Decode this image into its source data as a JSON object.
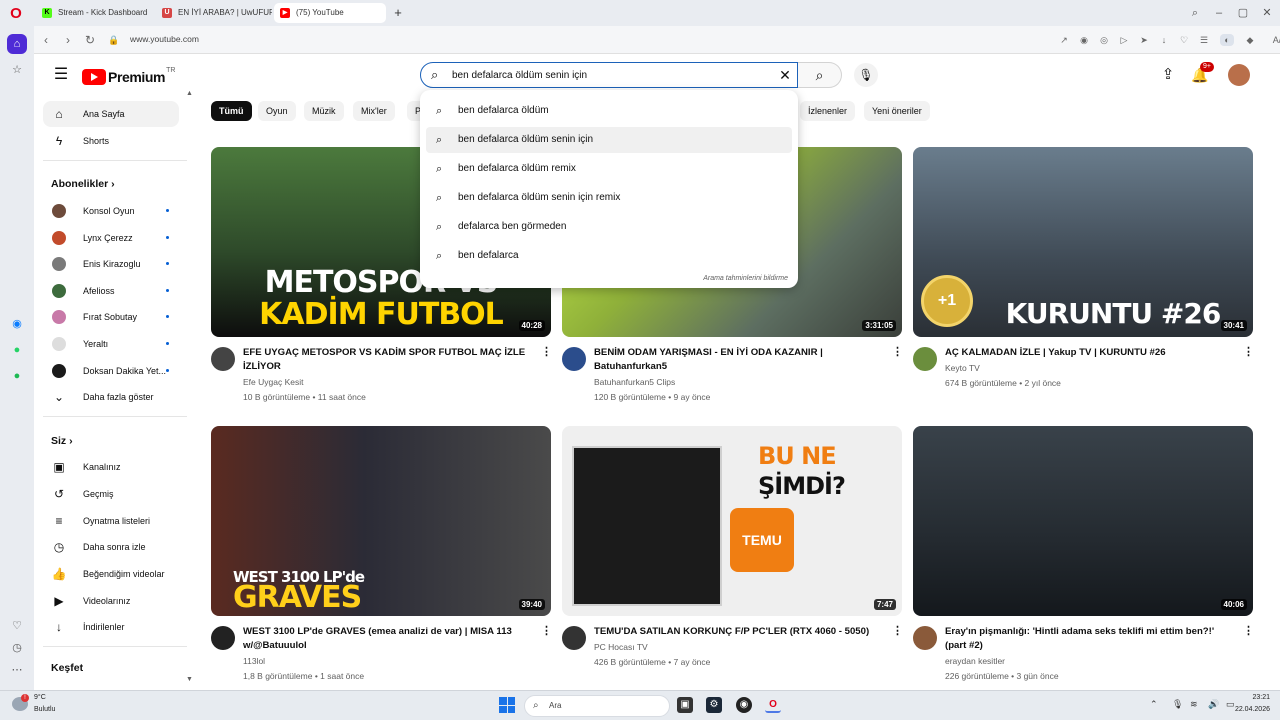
{
  "browser": {
    "tabs": [
      {
        "label": "Stream - Kick Dashboard",
        "fav": "K",
        "fav_color": "#53fc18"
      },
      {
        "label": "EN İYİ ARABA? | UwUFUFU",
        "fav": "U",
        "fav_color": "#d64545"
      },
      {
        "label": "(75) YouTube",
        "fav": "▶",
        "fav_color": "#ff0000"
      }
    ],
    "url": "www.youtube.com"
  },
  "youtube": {
    "logo_text": "Premium",
    "logo_region": "TR",
    "search_query": "ben defalarca öldüm senin için",
    "notif_count": "9+",
    "suggestions": [
      {
        "prefix": "ben defalarca ",
        "bold": "öldüm"
      },
      {
        "prefix": "ben defalarca ",
        "bold": "öldüm senin için"
      },
      {
        "prefix": "ben defalarca ",
        "bold": "öldüm remix"
      },
      {
        "prefix": "ben defalarca ",
        "bold": "öldüm senin için remix"
      },
      {
        "prefix": "defalarca ben ",
        "bold": "görmeden"
      },
      {
        "prefix": "ben defalarca",
        "bold": ""
      }
    ],
    "suggest_footer": "Arama tahminlerini bildirme",
    "nav": {
      "home": "Ana Sayfa",
      "shorts": "Shorts",
      "subs_heading": "Abonelikler",
      "subscriptions": [
        {
          "name": "Konsol Oyun",
          "color": "#6d4b3b"
        },
        {
          "name": "Lynx Çerezz",
          "color": "#c24b2b"
        },
        {
          "name": "Enis Kirazoglu",
          "color": "#7a7a7a"
        },
        {
          "name": "Afelioss",
          "color": "#3d6b3d"
        },
        {
          "name": "Fırat Sobutay",
          "color": "#c879a8"
        },
        {
          "name": "Yeraltı",
          "color": "#dddddd"
        },
        {
          "name": "Doksan Dakika Yet...",
          "color": "#1a1a1a"
        }
      ],
      "show_more": "Daha fazla göster",
      "you_heading": "Siz",
      "you_items": [
        {
          "label": "Kanalınız",
          "icon": "👤"
        },
        {
          "label": "Geçmiş",
          "icon": "↺"
        },
        {
          "label": "Oynatma listeleri",
          "icon": "≡"
        },
        {
          "label": "Daha sonra izle",
          "icon": "◷"
        },
        {
          "label": "Beğendiğim videolar",
          "icon": "👍"
        },
        {
          "label": "Videolarınız",
          "icon": "▶"
        },
        {
          "label": "İndirilenler",
          "icon": "↓"
        }
      ],
      "explore_heading": "Keşfet"
    },
    "chips": [
      "Tümü",
      "Oyun",
      "Müzik",
      "Mix'ler",
      "P",
      "İzlenenler",
      "Yeni öneriler"
    ],
    "videos": [
      {
        "title": "EFE UYGAÇ METOSPOR VS KADİM SPOR FUTBOL MAÇ İZLE İZLİYOR",
        "channel": "Efe Uygaç Kesit",
        "meta": "10 B görüntüleme • 11 saat önce",
        "duration": "40:28",
        "thumb_text1": "METOSPOR VS",
        "thumb_text2": "KADİM FUTBOL",
        "thumb_bg": "#3e6b35",
        "av_color": "#444"
      },
      {
        "title": "BENİM ODAM YARIŞMASI - EN İYİ ODA KAZANIR | Batuhanfurkan5",
        "channel": "Batuhanfurkan5 Clips",
        "meta": "120 B görüntüleme • 9 ay önce",
        "duration": "3:31:05",
        "thumb_text1": "",
        "thumb_text2": "",
        "thumb_bg": "#9aa89a",
        "av_color": "#2b4d8c"
      },
      {
        "title": "AÇ KALMADAN İZLE | Yakup TV | KURUNTU #26",
        "channel": "Keyto TV",
        "meta": "674 B görüntüleme • 2 yıl önce",
        "duration": "30:41",
        "thumb_text1": "",
        "thumb_text2": "KURUNTU #26",
        "thumb_bg": "#4a5a6a",
        "av_color": "#6b8e3d"
      },
      {
        "title": "WEST 3100 LP'de GRAVES (emea analizi de var) | MISA 113 w/@Batuuulol",
        "channel": "113lol",
        "meta": "1,8 B görüntüleme • 1 saat önce",
        "duration": "39:40",
        "thumb_text1": "WEST 3100 LP'de",
        "thumb_text2": "GRAVES",
        "thumb_bg": "#3a2a2a",
        "av_color": "#222"
      },
      {
        "title": "TEMU'DA SATILAN KORKUNÇ F/P PC'LER (RTX 4060 - 5050)",
        "channel": "PC Hocası TV",
        "meta": "426 B görüntüleme • 7 ay önce",
        "duration": "7:47",
        "thumb_text1": "BU NE",
        "thumb_text2": "ŞİMDİ?",
        "thumb_bg": "#e9e9e9",
        "av_color": "#333"
      },
      {
        "title": "Eray'ın pişmanlığı: 'Hintli adama seks teklifi mi ettim ben?!' (part #2)",
        "channel": "eraydan kesitler",
        "meta": "226 görüntüleme • 3 gün önce",
        "duration": "40:06",
        "thumb_text1": "",
        "thumb_text2": "",
        "thumb_bg": "#2c3238",
        "av_color": "#8a5a3a"
      }
    ],
    "temu_label": "TEMU"
  },
  "taskbar": {
    "temp": "9°C",
    "weather": "Bulutlu",
    "search_placeholder": "Ara",
    "time": "23:21",
    "date": "22.04.2026"
  }
}
